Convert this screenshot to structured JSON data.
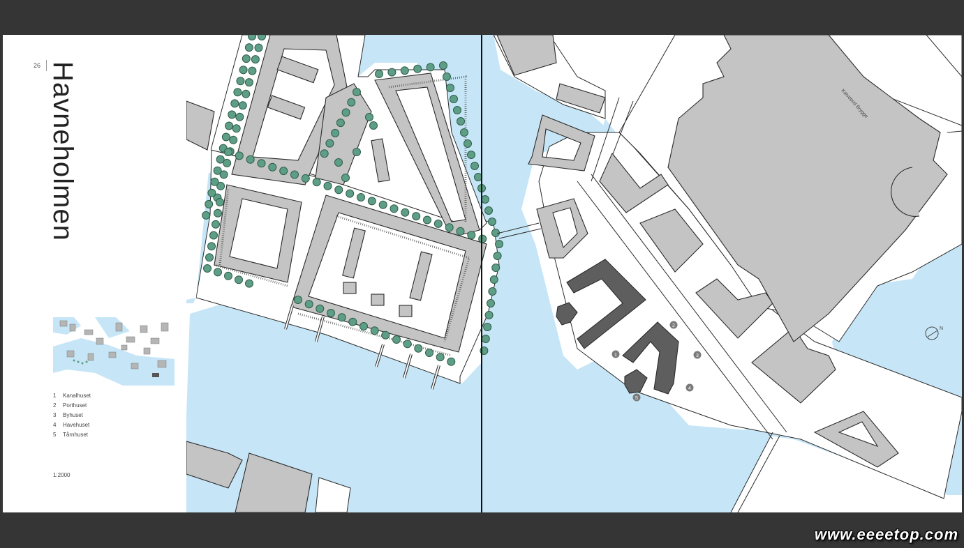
{
  "page": {
    "number": "26",
    "title": "Havneholmen"
  },
  "legend": [
    {
      "n": "1",
      "label": "Kanalhuset"
    },
    {
      "n": "2",
      "label": "Porthuset"
    },
    {
      "n": "3",
      "label": "Byhuset"
    },
    {
      "n": "4",
      "label": "Havehuset"
    },
    {
      "n": "5",
      "label": "Tårnhuset"
    }
  ],
  "scale": "1:2000",
  "map": {
    "street_label": "Kalvebod Brygge",
    "north_label": "N",
    "markers": [
      "1",
      "2",
      "3",
      "4",
      "5"
    ],
    "colors": {
      "water": "#c6e6f7",
      "building": "#c4c4c4",
      "highlighted_building": "#5e5e5e",
      "tree": "#5f9e86"
    }
  },
  "watermark": "www.eeeetop.com"
}
